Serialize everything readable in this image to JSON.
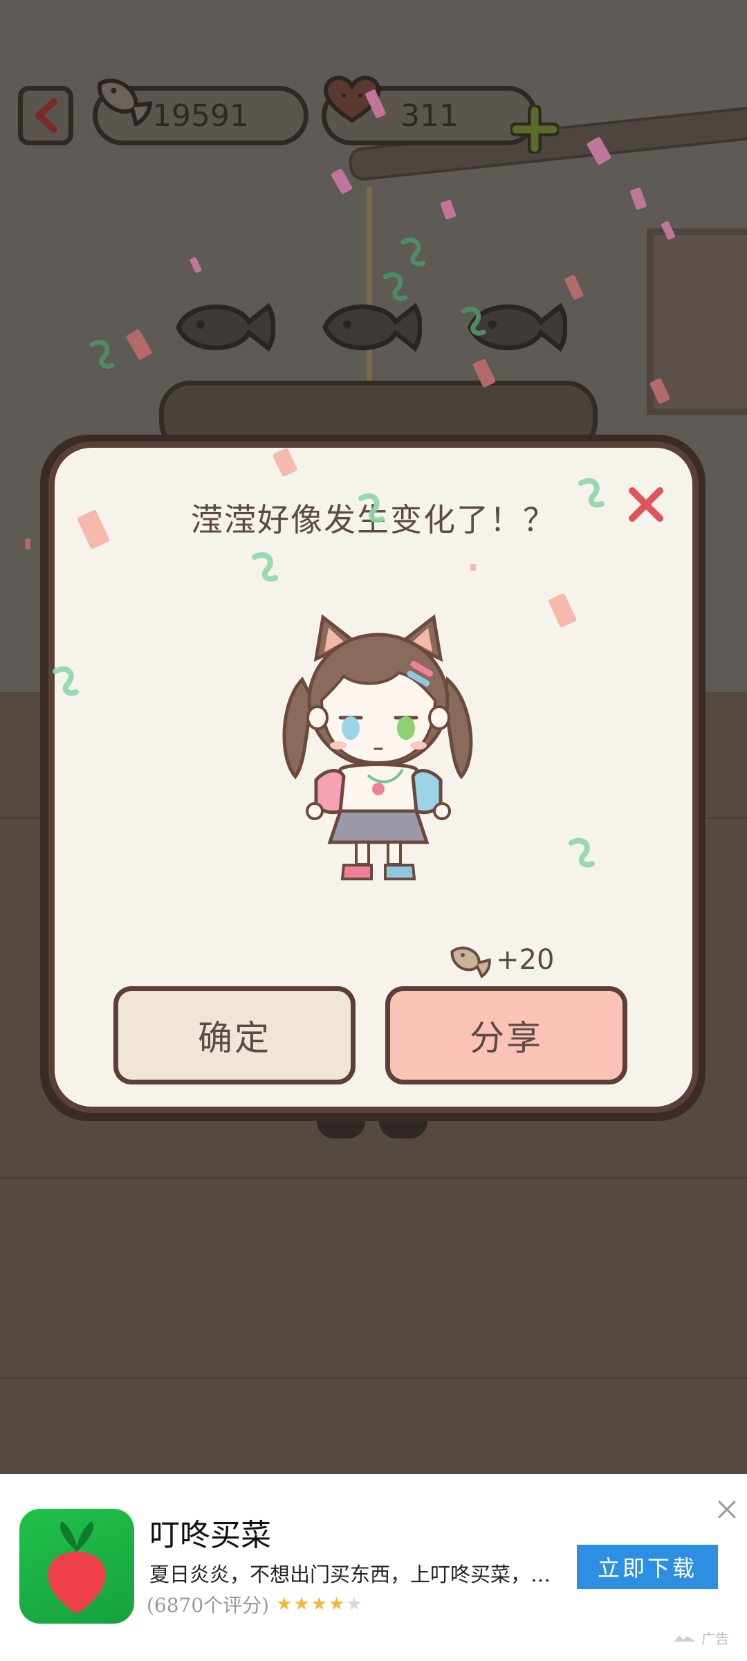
{
  "top_bar": {
    "back_icon": "chevron-left-icon",
    "fish_count": "19591",
    "heart_count": "311",
    "plus_icon": "plus-icon"
  },
  "dialog": {
    "title": "滢滢好像发生变化了！？",
    "close_icon": "close-icon",
    "reward_icon": "fish-icon",
    "reward_text": "+20",
    "confirm_label": "确定",
    "share_label": "分享"
  },
  "ad": {
    "app_name": "叮咚买菜",
    "description": "夏日炎炎，不想出门买东西，上叮咚买菜，…",
    "rating_text": "(6870个评分)",
    "stars_filled": 4,
    "stars_total": 5,
    "download_label": "立即下载",
    "ad_label": "广告"
  },
  "colors": {
    "dialog_bg": "#f6f3ec",
    "dialog_border": "#5a4038",
    "confirm_bg": "#efe6d8",
    "share_bg": "#fcc4b6",
    "close_red": "#e0555a",
    "ad_button_blue": "#2d8fe1",
    "ad_icon_green": "#1db445"
  }
}
